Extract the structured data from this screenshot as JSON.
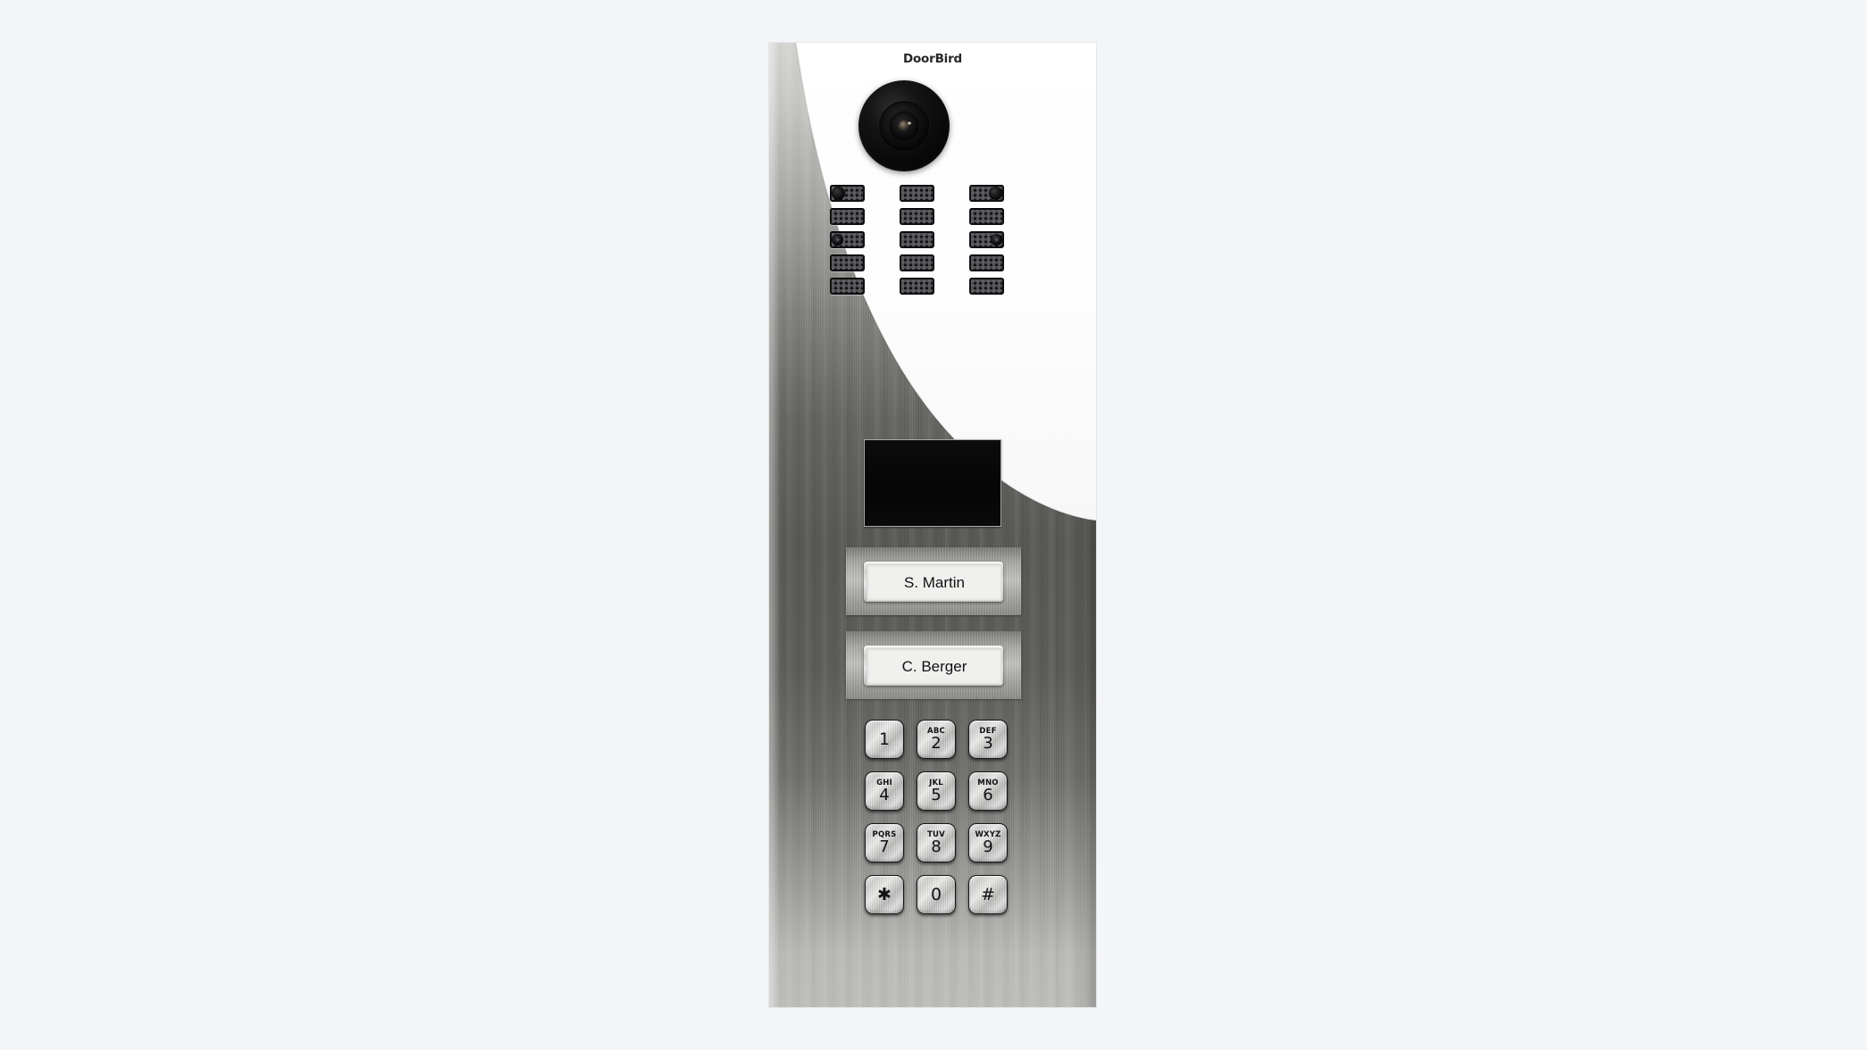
{
  "scene": {
    "subject": "DoorBird IP video door station",
    "background_color": "#f4f5f7"
  },
  "device": {
    "brand_logo": "DoorBird",
    "finish": "brushed stainless steel with white front panel",
    "camera": {
      "label": "camera-lens"
    },
    "speaker_grille": {
      "rows": 5,
      "columns": 3,
      "vents": [
        {
          "row": 1,
          "col": 1,
          "dot": "left"
        },
        {
          "row": 1,
          "col": 2,
          "dot": "none"
        },
        {
          "row": 1,
          "col": 3,
          "dot": "right"
        },
        {
          "row": 2,
          "col": 1,
          "dot": "none"
        },
        {
          "row": 2,
          "col": 2,
          "dot": "none"
        },
        {
          "row": 2,
          "col": 3,
          "dot": "none"
        },
        {
          "row": 3,
          "col": 1,
          "dot": "left-lens"
        },
        {
          "row": 3,
          "col": 2,
          "dot": "none"
        },
        {
          "row": 3,
          "col": 3,
          "dot": "right-lens"
        },
        {
          "row": 4,
          "col": 1,
          "dot": "none"
        },
        {
          "row": 4,
          "col": 2,
          "dot": "none"
        },
        {
          "row": 4,
          "col": 3,
          "dot": "none"
        },
        {
          "row": 5,
          "col": 1,
          "dot": "none"
        },
        {
          "row": 5,
          "col": 2,
          "dot": "none"
        },
        {
          "row": 5,
          "col": 3,
          "dot": "none"
        }
      ]
    },
    "display_module": {
      "name": "info-display",
      "screen_text": "",
      "state": "off"
    },
    "nameplates": [
      {
        "name": "S. Martin"
      },
      {
        "name": "C. Berger"
      }
    ],
    "keypad": {
      "keys": [
        {
          "digit": "1",
          "letters": ""
        },
        {
          "digit": "2",
          "letters": "ABC"
        },
        {
          "digit": "3",
          "letters": "DEF"
        },
        {
          "digit": "4",
          "letters": "GHI"
        },
        {
          "digit": "5",
          "letters": "JKL"
        },
        {
          "digit": "6",
          "letters": "MNO"
        },
        {
          "digit": "7",
          "letters": "PQRS"
        },
        {
          "digit": "8",
          "letters": "TUV"
        },
        {
          "digit": "9",
          "letters": "WXYZ"
        },
        {
          "digit": "✱",
          "letters": ""
        },
        {
          "digit": "0",
          "letters": ""
        },
        {
          "digit": "#",
          "letters": ""
        }
      ]
    }
  },
  "colors": {
    "backdrop": "#f4f5f7",
    "white_panel": "#ffffff",
    "steel_light": "#c8c8c6",
    "steel_mid": "#8b8b88",
    "steel_dark": "#565653",
    "steel_bottom": "#b8b8b5",
    "logo_text": "#26262a",
    "nameplate_text": "#111111",
    "key_text": "#121214",
    "screen_black": "#0a0a0a"
  }
}
